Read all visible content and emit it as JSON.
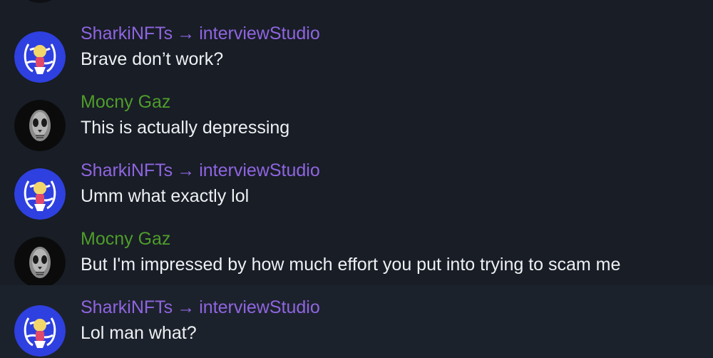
{
  "colors": {
    "background": "#181d26",
    "highlight_row": "#1c222c",
    "username_purple": "#8f65e0",
    "username_green": "#4f9d2a",
    "message_text": "#eef0f3",
    "avatar_blue": "#2f40e0"
  },
  "icons": {
    "arrow": "→"
  },
  "messages": [
    {
      "sender": "SharkiNFTs",
      "recipient": "interviewStudio",
      "avatar_icon": "anime-nft-avatar-icon",
      "text": "Brave don’t work?"
    },
    {
      "sender": "Mocny Gaz",
      "recipient": "",
      "avatar_icon": "skull-mask-avatar-icon",
      "text": "This is actually depressing"
    },
    {
      "sender": "SharkiNFTs",
      "recipient": "interviewStudio",
      "avatar_icon": "anime-nft-avatar-icon",
      "text": "Umm what exactly lol"
    },
    {
      "sender": "Mocny Gaz",
      "recipient": "",
      "avatar_icon": "skull-mask-avatar-icon",
      "text": "But I'm impressed by how much effort you put into trying to scam me"
    },
    {
      "sender": "SharkiNFTs",
      "recipient": "interviewStudio",
      "avatar_icon": "anime-nft-avatar-icon",
      "text": "Lol man what?"
    }
  ]
}
